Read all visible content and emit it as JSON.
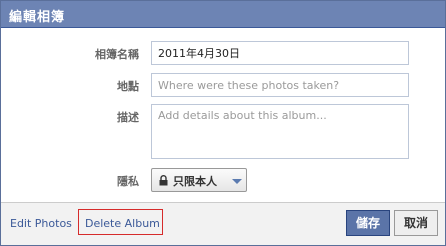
{
  "dialog": {
    "title": "編輯相簿"
  },
  "form": {
    "album_name": {
      "label": "相簿名稱",
      "value": "2011年4月30日"
    },
    "location": {
      "label": "地點",
      "placeholder": "Where were these photos taken?"
    },
    "description": {
      "label": "描述",
      "placeholder": "Add details about this album..."
    },
    "privacy": {
      "label": "隱私",
      "selected": "只限本人",
      "icon": "lock-icon"
    }
  },
  "footer": {
    "edit_photos": "Edit Photos",
    "delete_album": "Delete Album",
    "save": "儲存",
    "cancel": "取消"
  },
  "colors": {
    "header": "#6d84b4",
    "link": "#3b5998",
    "save_button": "#5b74a8",
    "highlight_border": "#d62b2b"
  }
}
